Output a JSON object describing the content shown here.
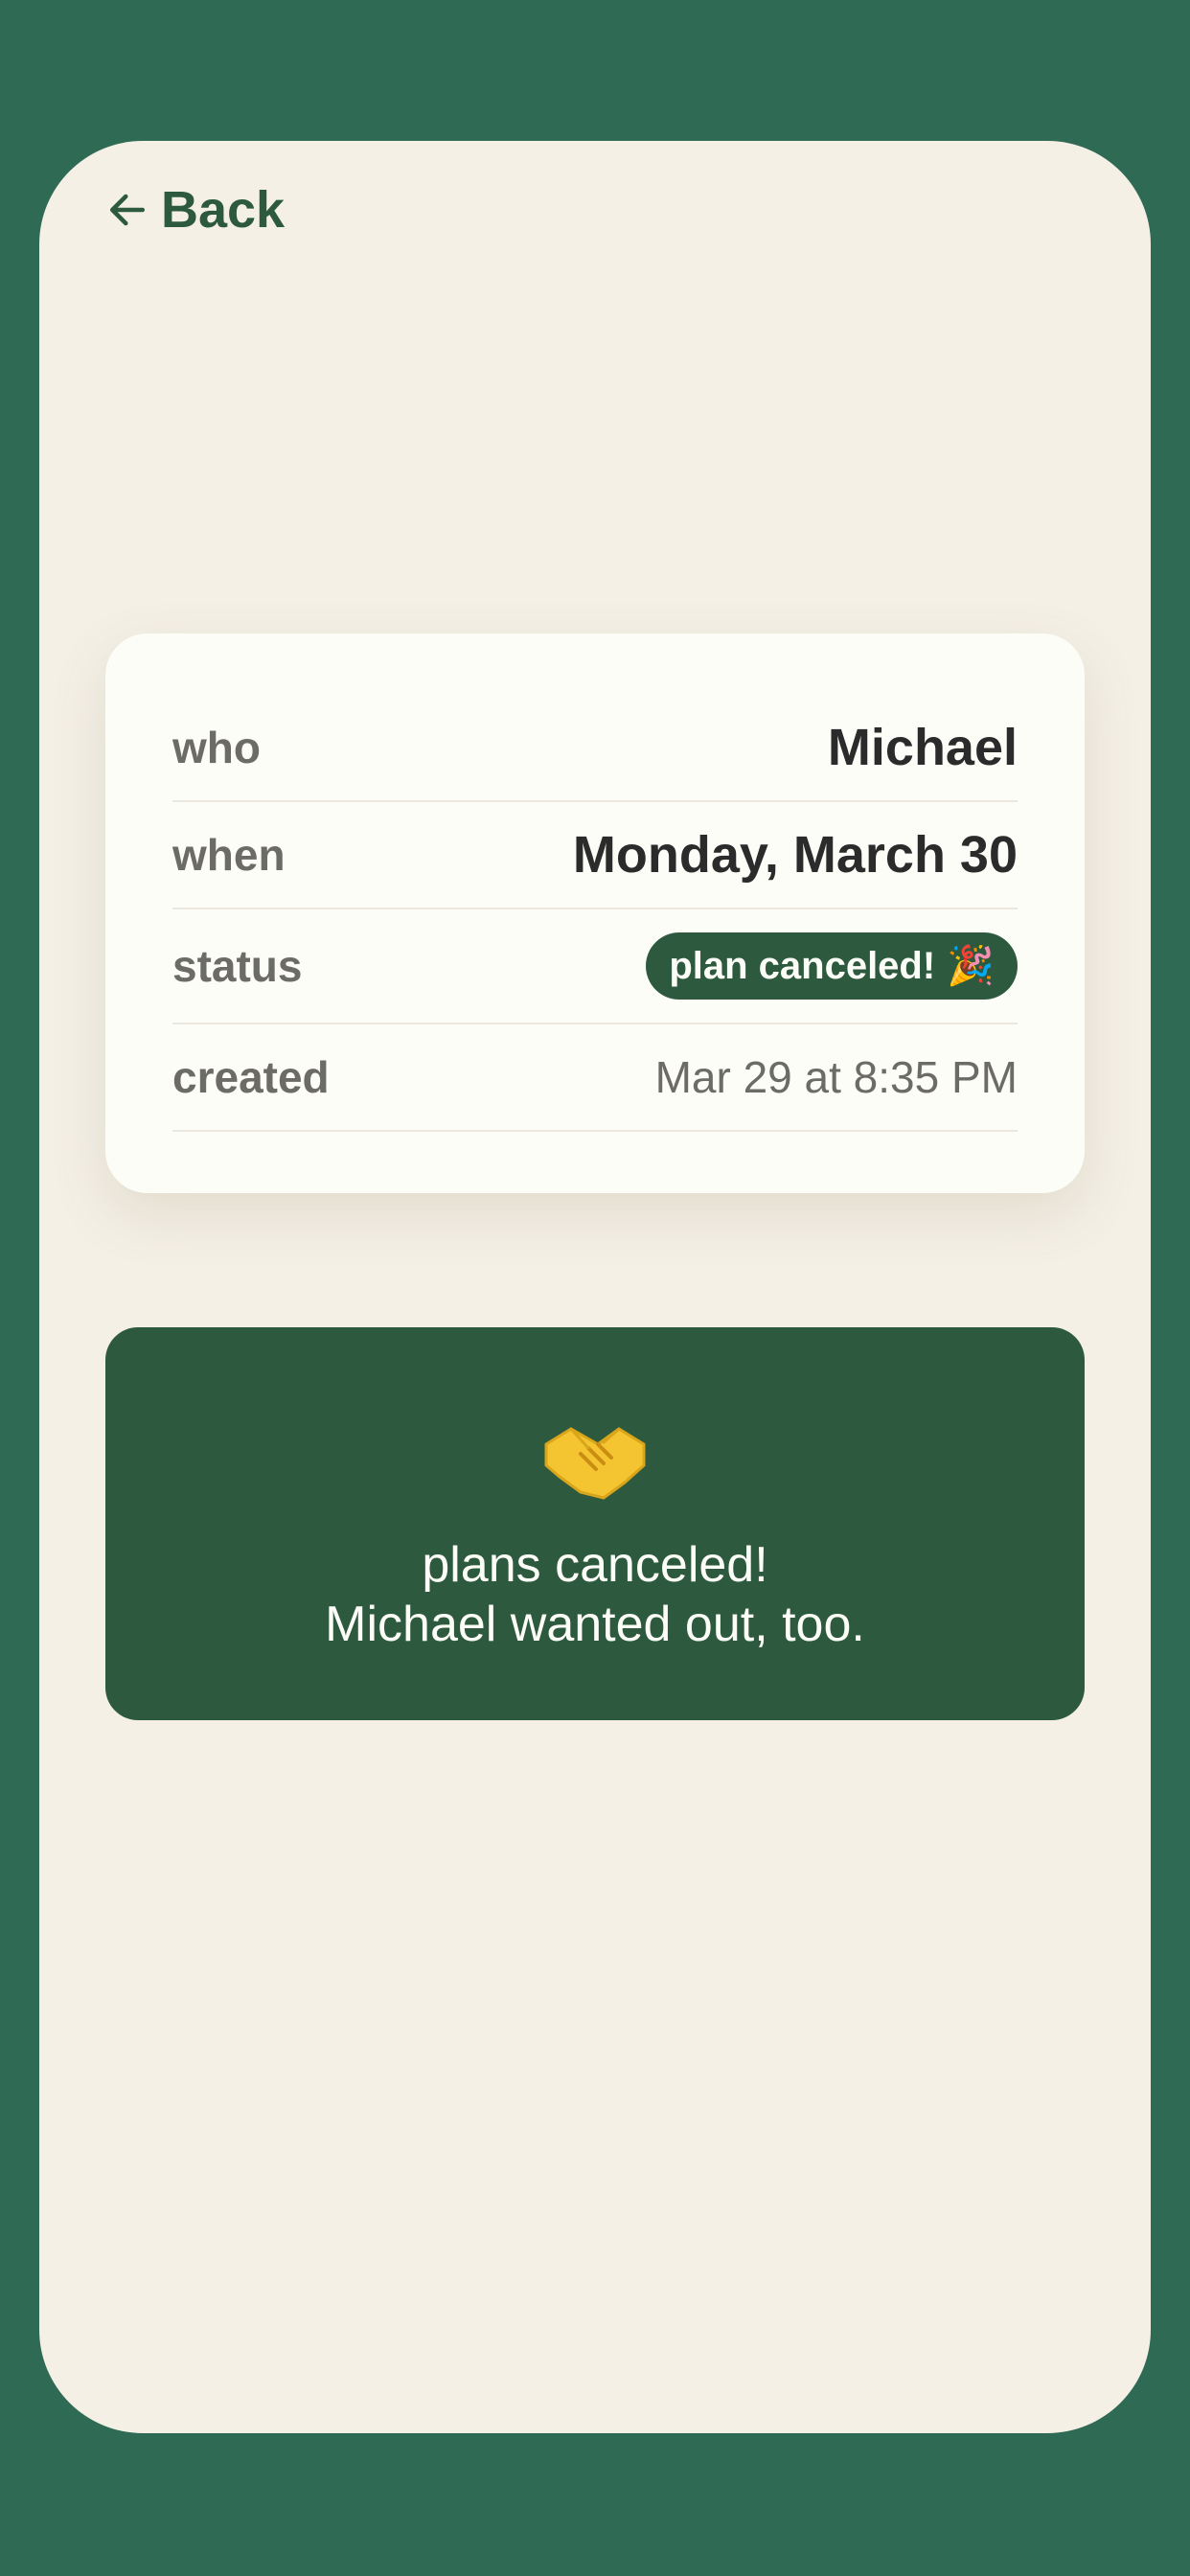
{
  "nav": {
    "back_label": "Back"
  },
  "details": {
    "rows": [
      {
        "label": "who",
        "value": "Michael"
      },
      {
        "label": "when",
        "value": "Monday, March 30"
      },
      {
        "label": "status",
        "value": "plan canceled!",
        "emoji": "🎉"
      },
      {
        "label": "created",
        "value": "Mar 29 at 8:35 PM"
      }
    ]
  },
  "result": {
    "icon": "handshake-icon",
    "line1": "plans canceled!",
    "line2": "Michael wanted out, too."
  },
  "colors": {
    "background": "#2f6a55",
    "screen": "#f4f0e6",
    "accent": "#2d5a3e",
    "card": "#fdfdf8"
  }
}
